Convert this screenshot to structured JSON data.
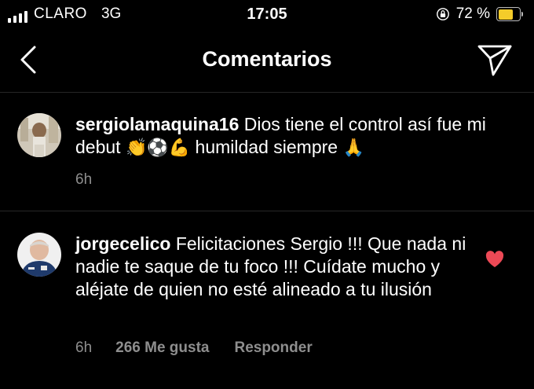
{
  "status_bar": {
    "carrier": "CLARO",
    "network": "3G",
    "time": "17:05",
    "battery_percent": "72 %",
    "battery_level": 0.72,
    "signal_bars": 4,
    "lock_icon": "orientation-lock-icon"
  },
  "nav": {
    "title": "Comentarios",
    "back_icon": "chevron-left-icon",
    "send_icon": "paper-plane-icon"
  },
  "caption": {
    "username": "sergiolamaquina16",
    "text_part1": " Dios tiene el control así fue mi debut ",
    "emojis_1": "👏⚽💪",
    "text_part2": " humildad siempre ",
    "emojis_2": "🙏",
    "time": "6h"
  },
  "comments": [
    {
      "username": "jorgecelico",
      "text": " Felicitaciones Sergio !!! Que nada ni nadie te saque de tu foco !!! Cuídate mucho y aléjate de quien no esté alineado a tu ilusión",
      "time": "6h",
      "likes": "266 Me gusta",
      "reply": "Responder",
      "liked": true,
      "heart_color": "#ed4956"
    }
  ]
}
